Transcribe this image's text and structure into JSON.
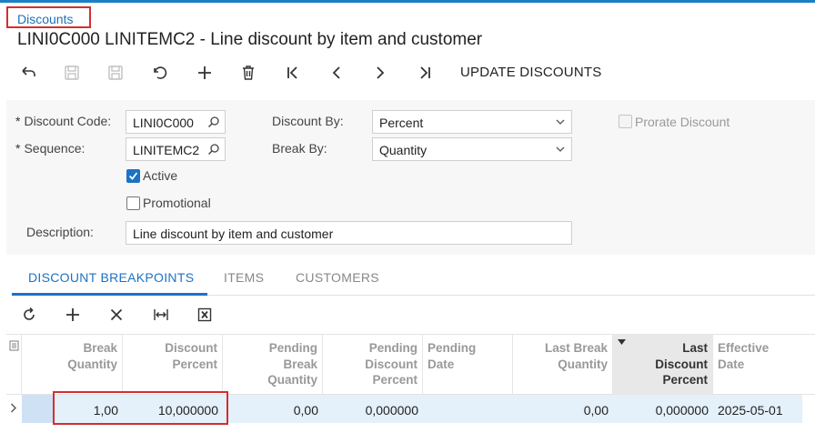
{
  "breadcrumb": "Discounts",
  "title": "LINI0C000 LINITEMC2 - Line discount by item and customer",
  "toolbar": {
    "update_label": "UPDATE DISCOUNTS"
  },
  "form": {
    "discount_code_label": "Discount Code:",
    "discount_code_value": "LINI0C000",
    "sequence_label": "Sequence:",
    "sequence_value": "LINITEMC2",
    "active_label": "Active",
    "active_checked": true,
    "promotional_label": "Promotional",
    "promotional_checked": false,
    "discount_by_label": "Discount By:",
    "discount_by_value": "Percent",
    "break_by_label": "Break By:",
    "break_by_value": "Quantity",
    "prorate_label": "Prorate Discount",
    "prorate_checked": false,
    "description_label": "Description:",
    "description_value": "Line discount by item and customer",
    "required_marker": "*"
  },
  "tabs": [
    {
      "label": "DISCOUNT BREAKPOINTS",
      "active": true
    },
    {
      "label": "ITEMS",
      "active": false
    },
    {
      "label": "CUSTOMERS",
      "active": false
    }
  ],
  "grid": {
    "columns": [
      {
        "line1": "Break",
        "line2": "Quantity",
        "line3": ""
      },
      {
        "line1": "Discount",
        "line2": "Percent",
        "line3": ""
      },
      {
        "line1": "Pending",
        "line2": "Break",
        "line3": "Quantity"
      },
      {
        "line1": "Pending",
        "line2": "Discount",
        "line3": "Percent"
      },
      {
        "line1": "Pending",
        "line2": "Date",
        "line3": ""
      },
      {
        "line1": "Last Break",
        "line2": "Quantity",
        "line3": ""
      },
      {
        "line1": "Last",
        "line2": "Discount",
        "line3": "Percent"
      },
      {
        "line1": "Effective",
        "line2": "Date",
        "line3": ""
      }
    ],
    "rows": [
      [
        "1,00",
        "10,000000",
        "0,00",
        "0,000000",
        "",
        "0,00",
        "0,000000",
        "2025-05-01"
      ]
    ]
  },
  "colors": {
    "accent": "#1c72c4",
    "highlight_border": "#d32f2f",
    "row_selected": "#e4f0fa"
  }
}
